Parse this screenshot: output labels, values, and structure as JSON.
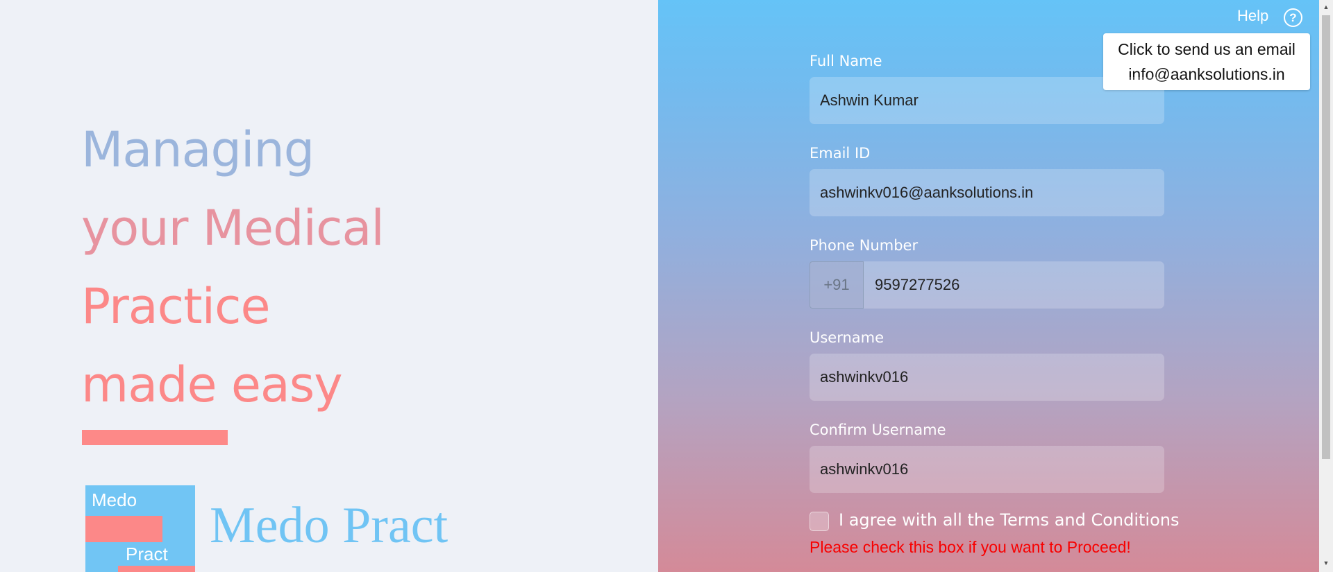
{
  "hero": {
    "line1": "Managing",
    "line2": "your Medical",
    "line3": "Practice",
    "line4": "made easy"
  },
  "logo": {
    "top_text": "Medo",
    "bottom_text": "Pract",
    "brand_name": "Medo Pract"
  },
  "help": {
    "label": "Help",
    "icon": "?",
    "tooltip_line1": "Click to send us an email",
    "tooltip_line2": "info@aanksolutions.in"
  },
  "form": {
    "full_name": {
      "label": "Full Name",
      "value": "Ashwin Kumar"
    },
    "email": {
      "label": "Email ID",
      "value": "ashwinkv016@aanksolutions.in"
    },
    "phone": {
      "label": "Phone Number",
      "prefix": "+91",
      "value": "9597277526"
    },
    "username": {
      "label": "Username",
      "value": "ashwinkv016"
    },
    "confirm_username": {
      "label": "Confirm Username",
      "value": "ashwinkv016"
    },
    "terms_label": "I agree with all the Terms and Conditions",
    "terms_error": "Please check this box if you want to Proceed!"
  },
  "colors": {
    "brand_blue": "#70c4f4",
    "brand_coral": "#fc8888",
    "error_red": "#f80000"
  }
}
